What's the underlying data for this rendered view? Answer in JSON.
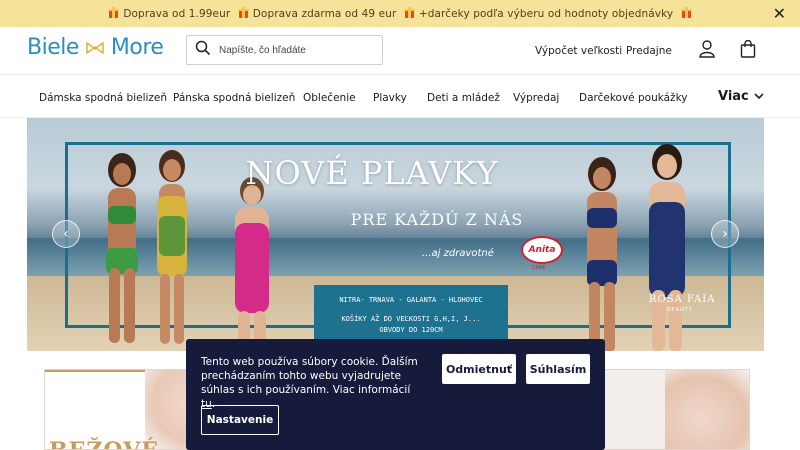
{
  "announcement": {
    "text": "Doprava od 1.99eur  Doprava zdarma od 49 eur  +darčeky podľa výberu od hodnoty objednávky",
    "close_icon": "close-icon"
  },
  "header": {
    "logo_left": "Biele",
    "logo_right": "More",
    "search_placeholder": "Napíšte, čo hľadáte",
    "links": [
      "Výpočet veľkosti",
      "Predajne"
    ],
    "account_icon": "user-icon",
    "cart_icon": "bag-icon"
  },
  "nav": {
    "items": [
      "Dámska spodná bielizeň",
      "Pánska spodná bielizeň",
      "Oblečenie",
      "Plavky",
      "Deti a mládež",
      "Výpredaj",
      "Darčekové poukážky"
    ],
    "more": "Viac"
  },
  "banner": {
    "title": "NOVÉ PLAVKY",
    "subtitle": "PRE KAŽDÚ Z NÁS",
    "tagline": "...aj zdravotné",
    "brand1": "Anita",
    "brand1_sub": "CARE",
    "brand2": "ROSA FAIA",
    "brand2_sub": "BEAUTY",
    "stores_line1": "NITRA- TRNAVA - GALANTA - HLOHOVEC",
    "stores_line2": "KOŠÍKY AŽ DO VEĽKOSTI G,H,I, J...",
    "stores_line3": "OBVODY DO 120CM",
    "prev_icon": "chevron-left-icon",
    "next_icon": "chevron-right-icon"
  },
  "promo": {
    "text": "BEŽOVÉ"
  },
  "cookie": {
    "text": "Tento web používa súbory cookie. Ďalším prechádzaním tohto webu vyjadrujete súhlas s ich používaním. Viac informácií ",
    "link": "tu",
    "tail": ".",
    "reject": "Odmietnuť",
    "accept": "Súhlasím",
    "settings": "Nastavenie"
  },
  "colors": {
    "announcement_bg": "#f6e39a",
    "brand_blue": "#2a8fc2",
    "cookie_bg": "#161b3c",
    "stores_box": "#1f7190"
  }
}
